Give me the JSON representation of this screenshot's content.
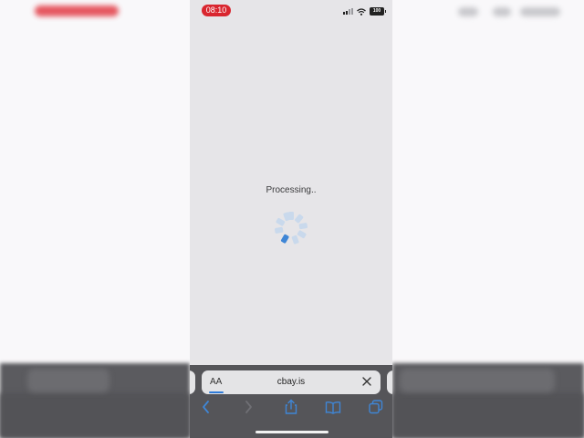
{
  "status_bar": {
    "time": "08:10",
    "battery": "100"
  },
  "page": {
    "message": "Processing.."
  },
  "address_bar": {
    "reader_label": "AA",
    "url": "cbay.is"
  },
  "colors": {
    "accent": "#2f7bd8",
    "time_pill": "#d9262f",
    "toolbar": "#555559"
  },
  "toolbar_icons": [
    "back-icon",
    "forward-icon",
    "share-icon",
    "bookmarks-icon",
    "tabs-icon"
  ]
}
